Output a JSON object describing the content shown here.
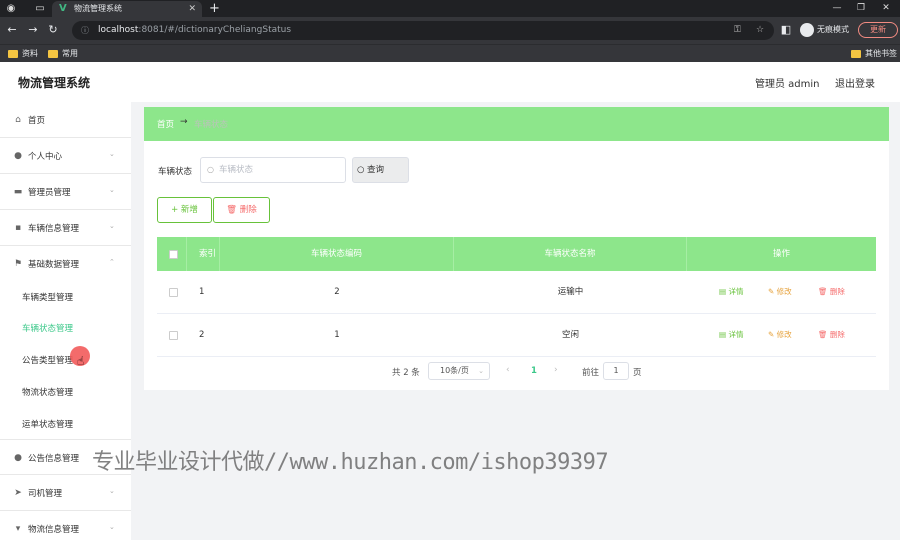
{
  "browser": {
    "tab_title": "物流管理系统",
    "url_host": "localhost",
    "url_rest": ":8081/#/dictionaryCheliangStatus",
    "incognito_label": "无痕模式",
    "update_label": "更新",
    "bookmarks": [
      "资料",
      "常用"
    ],
    "other_bookmarks": "其他书签"
  },
  "app": {
    "title": "物流管理系统",
    "user": "管理员 admin",
    "logout": "退出登录"
  },
  "sidebar": {
    "items": [
      {
        "label": "首页",
        "icon": "home-icon"
      },
      {
        "label": "个人中心",
        "icon": "user-icon"
      },
      {
        "label": "管理员管理",
        "icon": "admin-icon"
      },
      {
        "label": "车辆信息管理",
        "icon": "message-icon"
      },
      {
        "label": "基础数据管理",
        "icon": "flag-icon"
      }
    ],
    "sub_items": [
      "车辆类型管理",
      "车辆状态管理",
      "公告类型管理",
      "物流状态管理",
      "运单状态管理"
    ],
    "active_sub": "车辆状态管理",
    "items_after": [
      {
        "label": "公告信息管理",
        "icon": "location-icon"
      },
      {
        "label": "司机管理",
        "icon": "send-icon"
      },
      {
        "label": "物流信息管理",
        "icon": "monitor-icon"
      }
    ]
  },
  "breadcrumb": {
    "home": "首页",
    "separator": "→",
    "current": "车辆状态"
  },
  "search": {
    "label": "车辆状态",
    "placeholder": "车辆状态",
    "value": "",
    "button": "查询"
  },
  "actions": {
    "add": "新增",
    "delete": "删除"
  },
  "table": {
    "columns": [
      "索引",
      "车辆状态编码",
      "车辆状态名称",
      "操作"
    ],
    "rows": [
      {
        "index": "1",
        "code": "2",
        "name": "运输中"
      },
      {
        "index": "2",
        "code": "1",
        "name": "空闲"
      }
    ],
    "row_actions": {
      "detail": "详情",
      "edit": "修改",
      "remove": "删除"
    }
  },
  "pagination": {
    "total": "共 2 条",
    "page_size": "10条/页",
    "current_page": "1",
    "goto_label": "前往",
    "goto_value": "1",
    "goto_unit": "页"
  },
  "watermark": "专业毕业设计代做//www.huzhan.com/ishop39397",
  "colors": {
    "accent_green": "#8de68b",
    "active_text": "#3cc88a",
    "success": "#67c23a",
    "warning": "#e6a23c",
    "danger": "#f56c6c"
  }
}
